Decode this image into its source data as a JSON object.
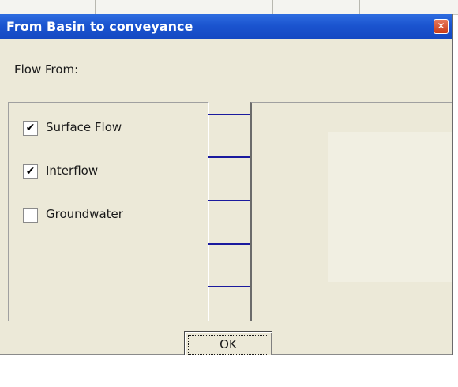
{
  "window": {
    "title": "From Basin to conveyance",
    "close_icon": "✕"
  },
  "flow_from": {
    "label": "Flow From:",
    "options": [
      {
        "label": "Surface Flow",
        "checked": true
      },
      {
        "label": "Interflow",
        "checked": true
      },
      {
        "label": "Groundwater",
        "checked": false
      }
    ]
  },
  "buttons": {
    "ok_label": "OK"
  },
  "colors": {
    "title_bar": "#1b54cf",
    "dialog_bg": "#ece9d8",
    "link_lines": "#1a1a9e"
  }
}
